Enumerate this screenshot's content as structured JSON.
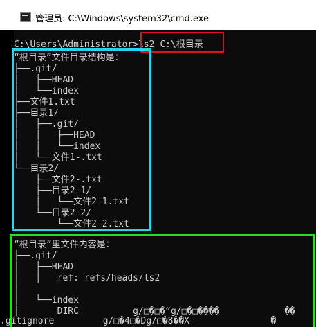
{
  "window": {
    "title": "管理员: C:\\Windows\\system32\\cmd.exe"
  },
  "terminal": {
    "lines": [
      "C:\\Users\\Administrator>ls2 C:\\根目录",
      "“根目录”文件目录结构是：",
      "├──.git/",
      "│   ├──HEAD",
      "│   └──index",
      "├──文件1.txt",
      "├──目录1/",
      "│   ├──.git/",
      "│   │   ├──HEAD",
      "│   │   └──index",
      "│   └──文件1-.txt",
      "└──目录2/",
      "    ├──文件2-.txt",
      "    ├──目录2-1/",
      "    │   └──文件2-1.txt",
      "    └──目录2-2/",
      "        └──文件2-2.txt",
      "",
      "“根目录”里文件内容是：",
      "├──.git/",
      "│   ├──HEAD",
      "│   │   ref: refs/heads/ls2",
      "│",
      "│   └──index",
      "│       DIRC          g/□�□�“g/□�□����            ��",
      ".gitignore         g/□�4□�Dg/□�8��X               �"
    ]
  },
  "colors": {
    "terminal_bg": "#0c0c0c",
    "terminal_text": "#cccccc",
    "highlight_red": "#e0141e",
    "highlight_cyan": "#2ad4e8",
    "highlight_green": "#22e022"
  },
  "icons": {
    "title": "console-icon"
  }
}
